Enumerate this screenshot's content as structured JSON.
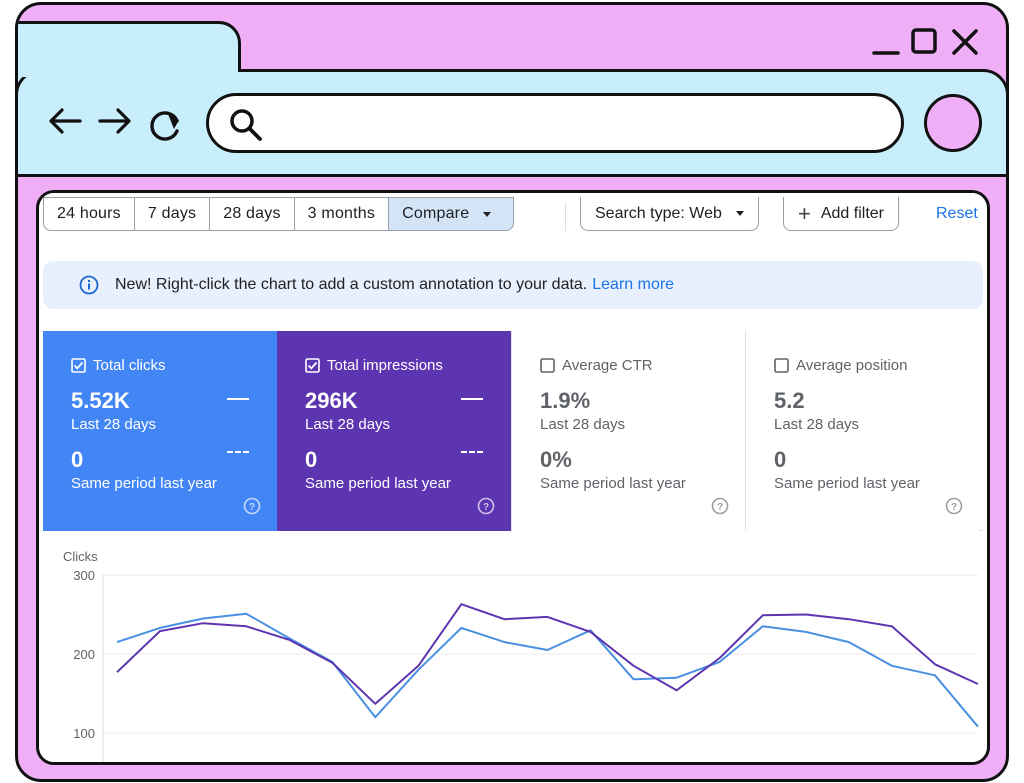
{
  "browser": {
    "window_controls": [
      "minimize-icon",
      "maximize-icon",
      "close-icon"
    ],
    "nav": [
      "arrow-left-icon",
      "arrow-right-icon",
      "reload-icon"
    ],
    "colors": {
      "frame": "#f0aef6",
      "toolbar": "#c7eefa"
    }
  },
  "filters": {
    "ranges": [
      "24 hours",
      "7 days",
      "28 days",
      "3 months"
    ],
    "compare": "Compare",
    "search_type": "Search type: Web",
    "add_filter": "Add filter",
    "reset": "Reset"
  },
  "banner": {
    "text": "New! Right-click the chart to add a custom annotation to your data.",
    "link": "Learn more"
  },
  "cards": [
    {
      "title": "Total clicks",
      "checked": true,
      "value": "5.52K",
      "period": "Last 28 days",
      "compare_value": "0",
      "compare_period": "Same period last year",
      "color": "#4285f4"
    },
    {
      "title": "Total impressions",
      "checked": true,
      "value": "296K",
      "period": "Last 28 days",
      "compare_value": "0",
      "compare_period": "Same period last year",
      "color": "#5e35b1"
    },
    {
      "title": "Average CTR",
      "checked": false,
      "value": "1.9%",
      "period": "Last 28 days",
      "compare_value": "0%",
      "compare_period": "Same period last year"
    },
    {
      "title": "Average position",
      "checked": false,
      "value": "5.2",
      "period": "Last 28 days",
      "compare_value": "0",
      "compare_period": "Same period last year"
    }
  ],
  "chart_data": {
    "type": "line",
    "ylabel": "Clicks",
    "ylim": [
      100,
      300
    ],
    "yticks": [
      300,
      200,
      100
    ],
    "grid": true,
    "series": [
      {
        "color": "#4a90e2",
        "values": [
          215,
          233,
          245,
          251,
          220,
          190,
          120,
          180,
          233,
          215,
          205,
          230,
          168,
          170,
          190,
          235,
          228,
          215,
          185,
          173,
          108
        ]
      },
      {
        "color": "#5e35b1",
        "values": [
          177,
          229,
          239,
          235,
          218,
          189,
          137,
          185,
          263,
          244,
          247,
          228,
          185,
          154,
          195,
          249,
          250,
          244,
          235,
          187,
          162
        ]
      }
    ]
  }
}
